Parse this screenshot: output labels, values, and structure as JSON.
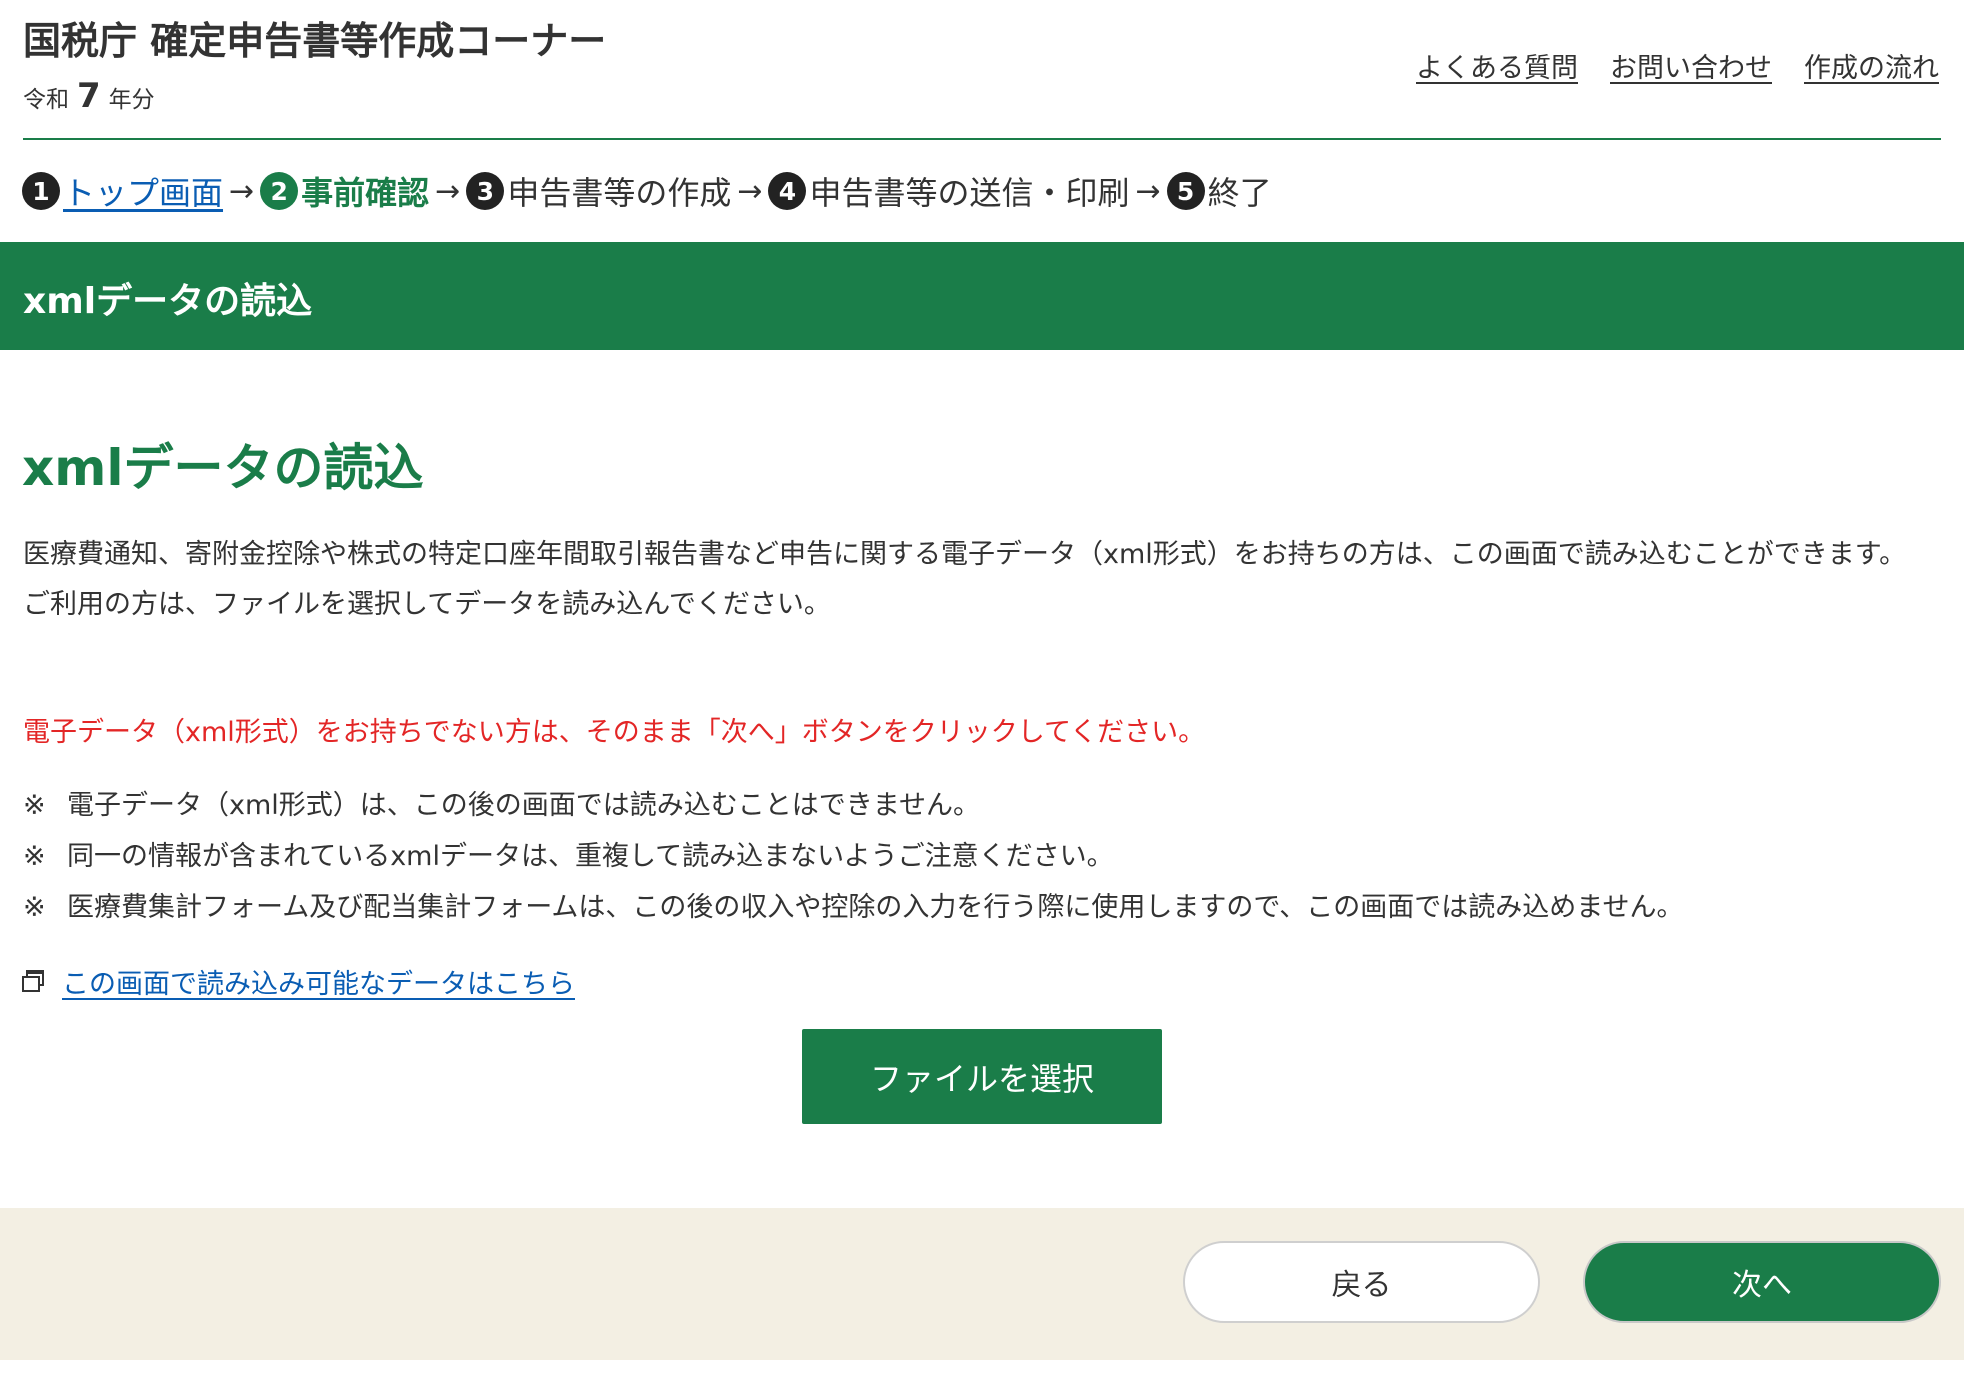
{
  "header": {
    "site_title": "国税庁 確定申告書等作成コーナー",
    "era": "令和",
    "year": "7",
    "year_suffix": "年分",
    "links": [
      "よくある質問",
      "お問い合わせ",
      "作成の流れ"
    ]
  },
  "steps": [
    {
      "num": "1",
      "label": "トップ画面",
      "state": "link"
    },
    {
      "num": "2",
      "label": "事前確認",
      "state": "current"
    },
    {
      "num": "3",
      "label": "申告書等の作成",
      "state": "upcoming"
    },
    {
      "num": "4",
      "label": "申告書等の送信・印刷",
      "state": "upcoming"
    },
    {
      "num": "5",
      "label": "終了",
      "state": "upcoming"
    }
  ],
  "step_arrow": "→",
  "banner": {
    "title": "xmlデータの読込"
  },
  "main": {
    "heading": "xmlデータの読込",
    "intro_lines": [
      "医療費通知、寄附金控除や株式の特定口座年間取引報告書など申告に関する電子データ（xml形式）をお持ちの方は、この画面で読み込むことができます。",
      "ご利用の方は、ファイルを選択してデータを読み込んでください。"
    ],
    "warning": "電子データ（xml形式）をお持ちでない方は、そのまま「次へ」ボタンをクリックしてください。",
    "note_mark": "※",
    "notes": [
      "電子データ（xml形式）は、この後の画面では読み込むことはできません。",
      "同一の情報が含まれているxmlデータは、重複して読み込まないようご注意ください。",
      "医療費集計フォーム及び配当集計フォームは、この後の収入や控除の入力を行う際に使用しますので、この画面では読み込めません。"
    ],
    "data_link": "この画面で読み込み可能なデータはこちら",
    "file_button": "ファイルを選択"
  },
  "footer": {
    "back_label": "戻る",
    "next_label": "次へ"
  },
  "colors": {
    "brand_green": "#1a7d49",
    "warning_red": "#e32626",
    "link_blue": "#0a5db3",
    "footer_bg": "#f3efe3"
  }
}
